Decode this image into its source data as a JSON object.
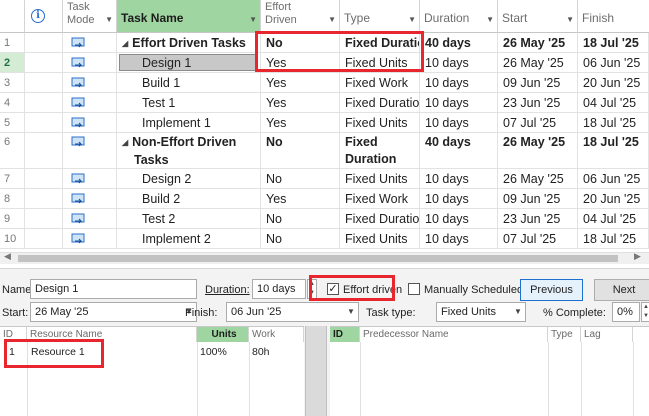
{
  "grid": {
    "headers": {
      "task_mode": "Task Mode",
      "task_name": "Task Name",
      "effort_driven": "Effort Driven",
      "type": "Type",
      "duration": "Duration",
      "start": "Start",
      "finish": "Finish"
    },
    "rows": [
      {
        "id": "1",
        "name": "Effort Driven Tasks",
        "effort": "No",
        "type": "Fixed Duration",
        "duration": "40 days",
        "start": "26 May '25",
        "finish": "18 Jul '25"
      },
      {
        "id": "2",
        "name": "Design 1",
        "effort": "Yes",
        "type": "Fixed Units",
        "duration": "10 days",
        "start": "26 May '25",
        "finish": "06 Jun '25"
      },
      {
        "id": "3",
        "name": "Build 1",
        "effort": "Yes",
        "type": "Fixed Work",
        "duration": "10 days",
        "start": "09 Jun '25",
        "finish": "20 Jun '25"
      },
      {
        "id": "4",
        "name": "Test 1",
        "effort": "Yes",
        "type": "Fixed Duration",
        "duration": "10 days",
        "start": "23 Jun '25",
        "finish": "04 Jul '25"
      },
      {
        "id": "5",
        "name": "Implement 1",
        "effort": "Yes",
        "type": "Fixed Units",
        "duration": "10 days",
        "start": "07 Jul '25",
        "finish": "18 Jul '25"
      },
      {
        "id": "6",
        "name_line1": "Non-Effort Driven",
        "name_line2": "Tasks",
        "effort": "No",
        "type_line1": "Fixed",
        "type_line2": "Duration",
        "duration": "40 days",
        "start": "26 May '25",
        "finish": "18 Jul '25"
      },
      {
        "id": "7",
        "name": "Design 2",
        "effort": "No",
        "type": "Fixed Units",
        "duration": "10 days",
        "start": "26 May '25",
        "finish": "06 Jun '25"
      },
      {
        "id": "8",
        "name": "Build 2",
        "effort": "Yes",
        "type": "Fixed Work",
        "duration": "10 days",
        "start": "09 Jun '25",
        "finish": "20 Jun '25"
      },
      {
        "id": "9",
        "name": "Test 2",
        "effort": "No",
        "type": "Fixed Duration",
        "duration": "10 days",
        "start": "23 Jun '25",
        "finish": "04 Jul '25"
      },
      {
        "id": "10",
        "name": "Implement 2",
        "effort": "No",
        "type": "Fixed Units",
        "duration": "10 days",
        "start": "07 Jul '25",
        "finish": "18 Jul '25"
      }
    ]
  },
  "form": {
    "name_label": "Name:",
    "name_value": "Design 1",
    "duration_label": "Duration:",
    "duration_value": "10 days",
    "effort_driven_label": "Effort driven",
    "effort_driven_checked": true,
    "manually_scheduled_label": "Manually Scheduled",
    "previous_button": "Previous",
    "next_button": "Next",
    "start_label": "Start:",
    "start_value": "26 May '25",
    "finish_label": "Finish:",
    "finish_value": "06 Jun '25",
    "task_type_label": "Task type:",
    "task_type_value": "Fixed Units",
    "percent_complete_label": "% Complete:",
    "percent_complete_value": "0%"
  },
  "resources": {
    "headers": {
      "id": "ID",
      "name": "Resource Name",
      "units": "Units",
      "work": "Work"
    },
    "rows": [
      {
        "id": "1",
        "name": "Resource 1",
        "units": "100%",
        "work": "80h"
      }
    ]
  },
  "predecessors": {
    "headers": {
      "id": "ID",
      "name": "Predecessor Name",
      "type": "Type",
      "lag": "Lag"
    }
  },
  "colors": {
    "selected_header": "#9fd5a1",
    "highlight_box": "#e8262d",
    "accent": "#217346"
  }
}
